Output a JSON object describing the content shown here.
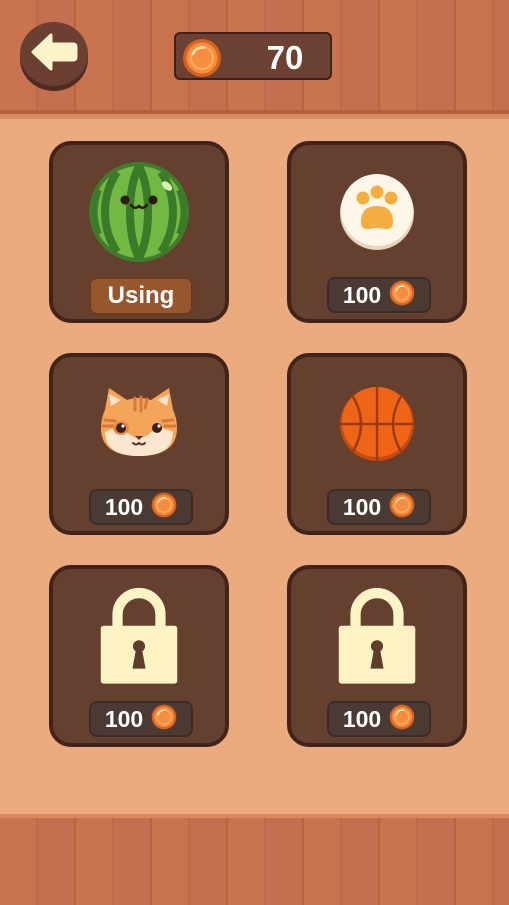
{
  "header": {
    "back_icon": "left-arrow-icon",
    "coins": "70",
    "coin_icon": "coin-icon"
  },
  "skins": [
    {
      "item": "watermelon",
      "status": "Using"
    },
    {
      "item": "cat-paw",
      "price": "100"
    },
    {
      "item": "cat-face",
      "price": "100"
    },
    {
      "item": "basketball",
      "price": "100"
    },
    {
      "item": "locked",
      "icon": "lock-icon",
      "price": "100"
    },
    {
      "item": "locked",
      "icon": "lock-icon",
      "price": "100"
    }
  ],
  "colors": {
    "background": "#ebab7f",
    "card": "#65402f",
    "card_border": "#40241b",
    "coin": "#f0883a",
    "using_badge": "#96562e"
  }
}
